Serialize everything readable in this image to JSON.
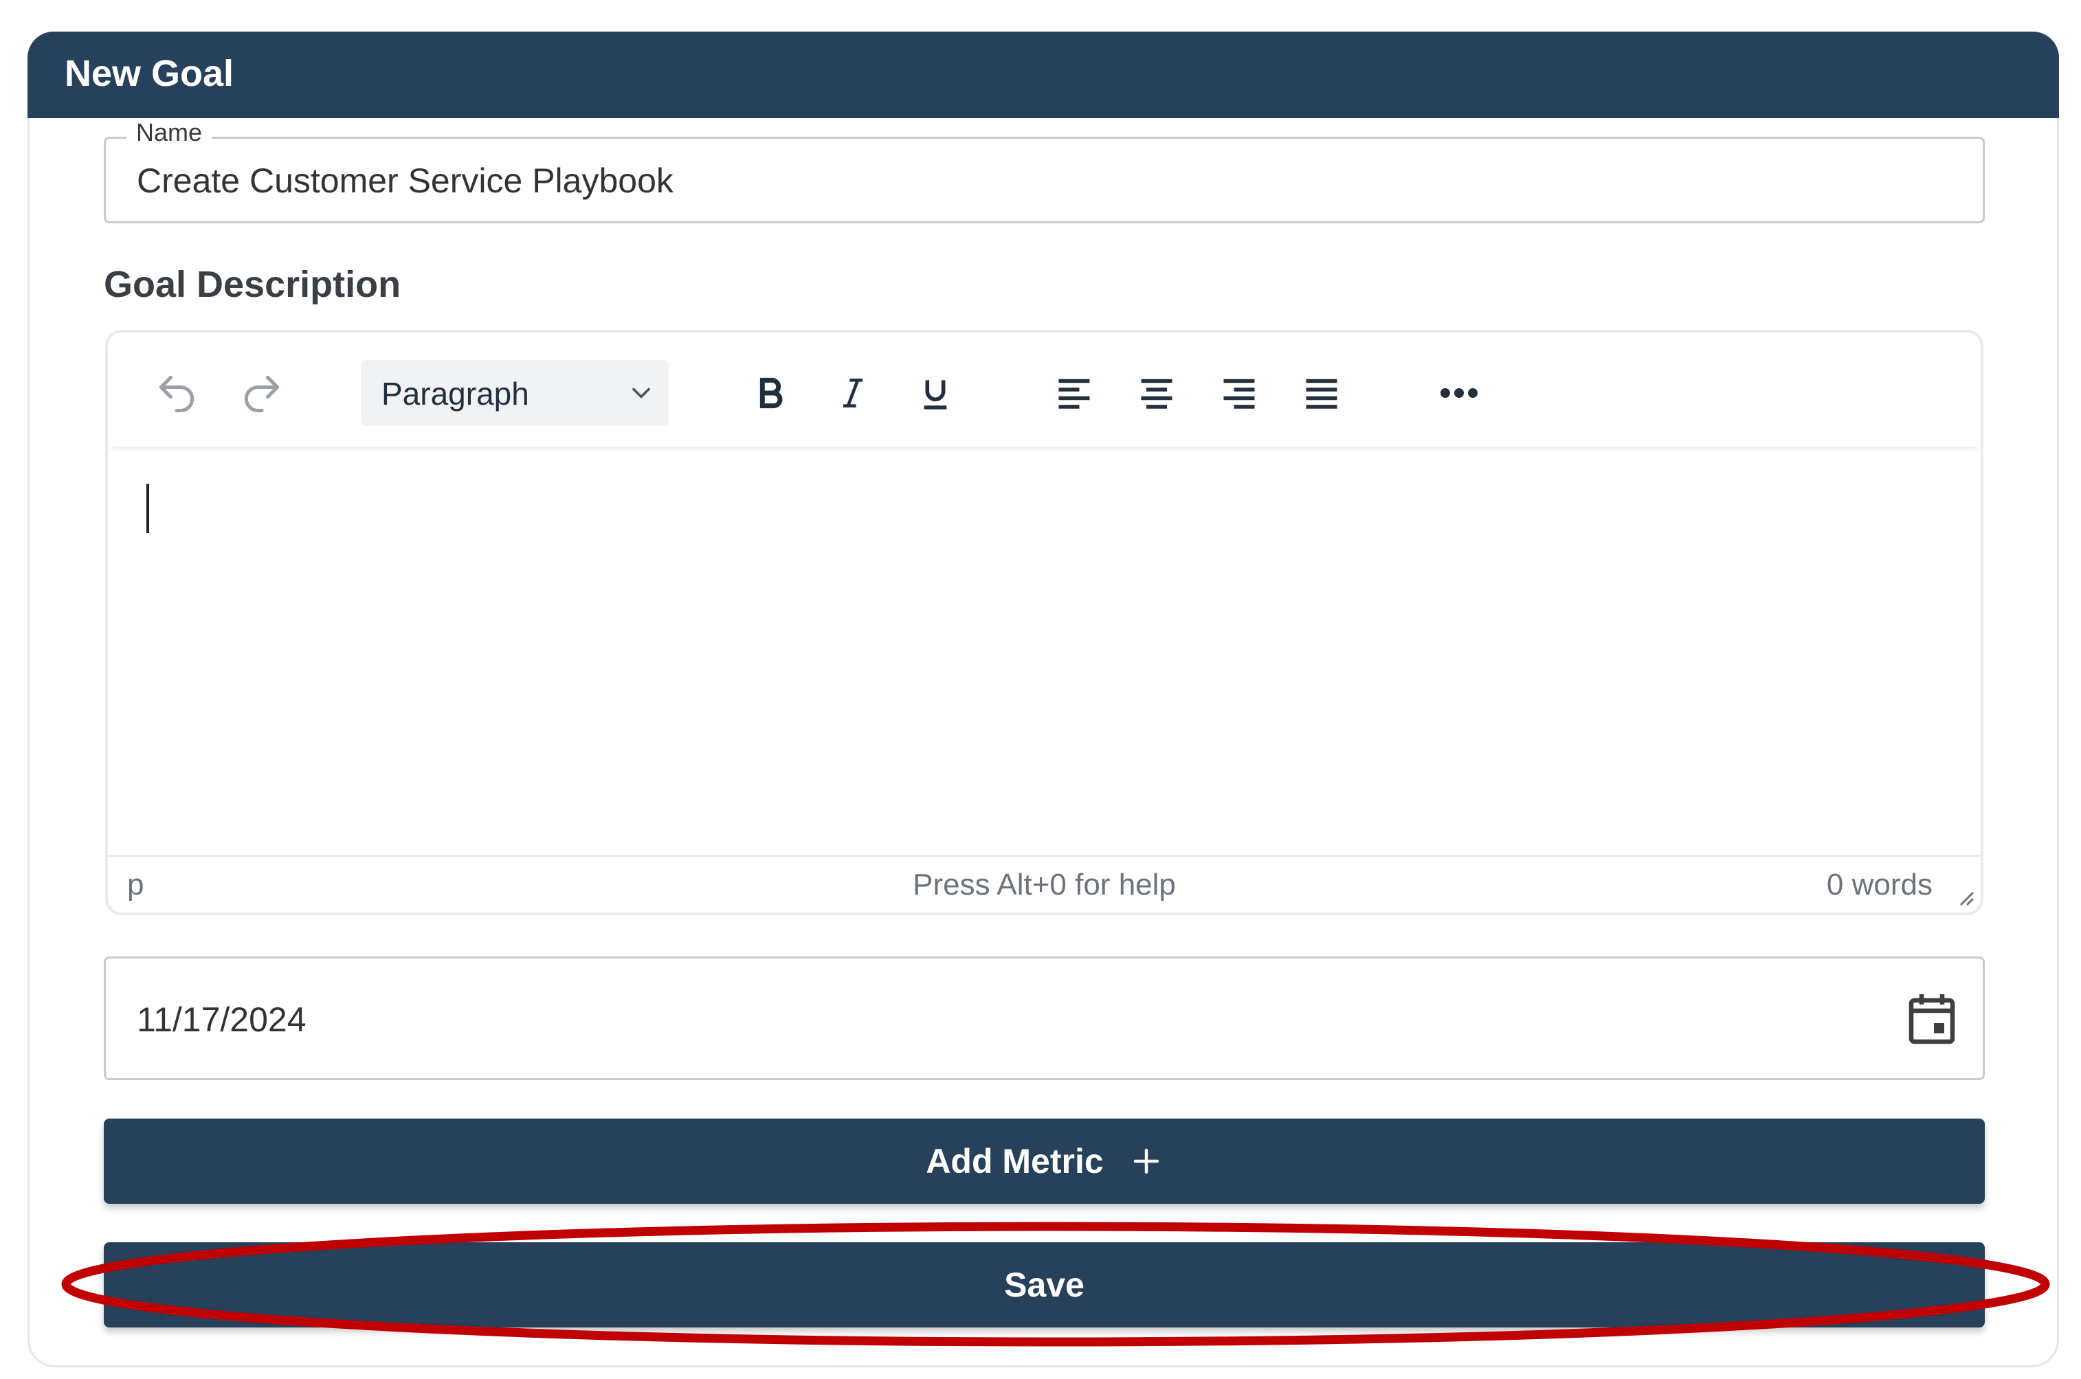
{
  "header": {
    "title": "New Goal"
  },
  "name_field": {
    "label": "Name",
    "value": "Create Customer Service Playbook"
  },
  "description": {
    "label": "Goal Description",
    "toolbar": {
      "undo_icon": "undo-icon",
      "redo_icon": "redo-icon",
      "block_format": "Paragraph",
      "buttons": [
        "bold-icon",
        "italic-icon",
        "underline-icon",
        "align-left-icon",
        "align-center-icon",
        "align-right-icon",
        "justify-icon",
        "more-icon"
      ]
    },
    "status": {
      "path": "p",
      "help": "Press Alt+0 for help",
      "word_count": "0 words"
    }
  },
  "date_field": {
    "value": "11/17/2024",
    "icon": "calendar-icon"
  },
  "buttons": {
    "add_metric": "Add Metric",
    "save": "Save"
  },
  "colors": {
    "header_bg": "#27415b",
    "button_bg": "#27415b",
    "highlight": "#c00000"
  }
}
